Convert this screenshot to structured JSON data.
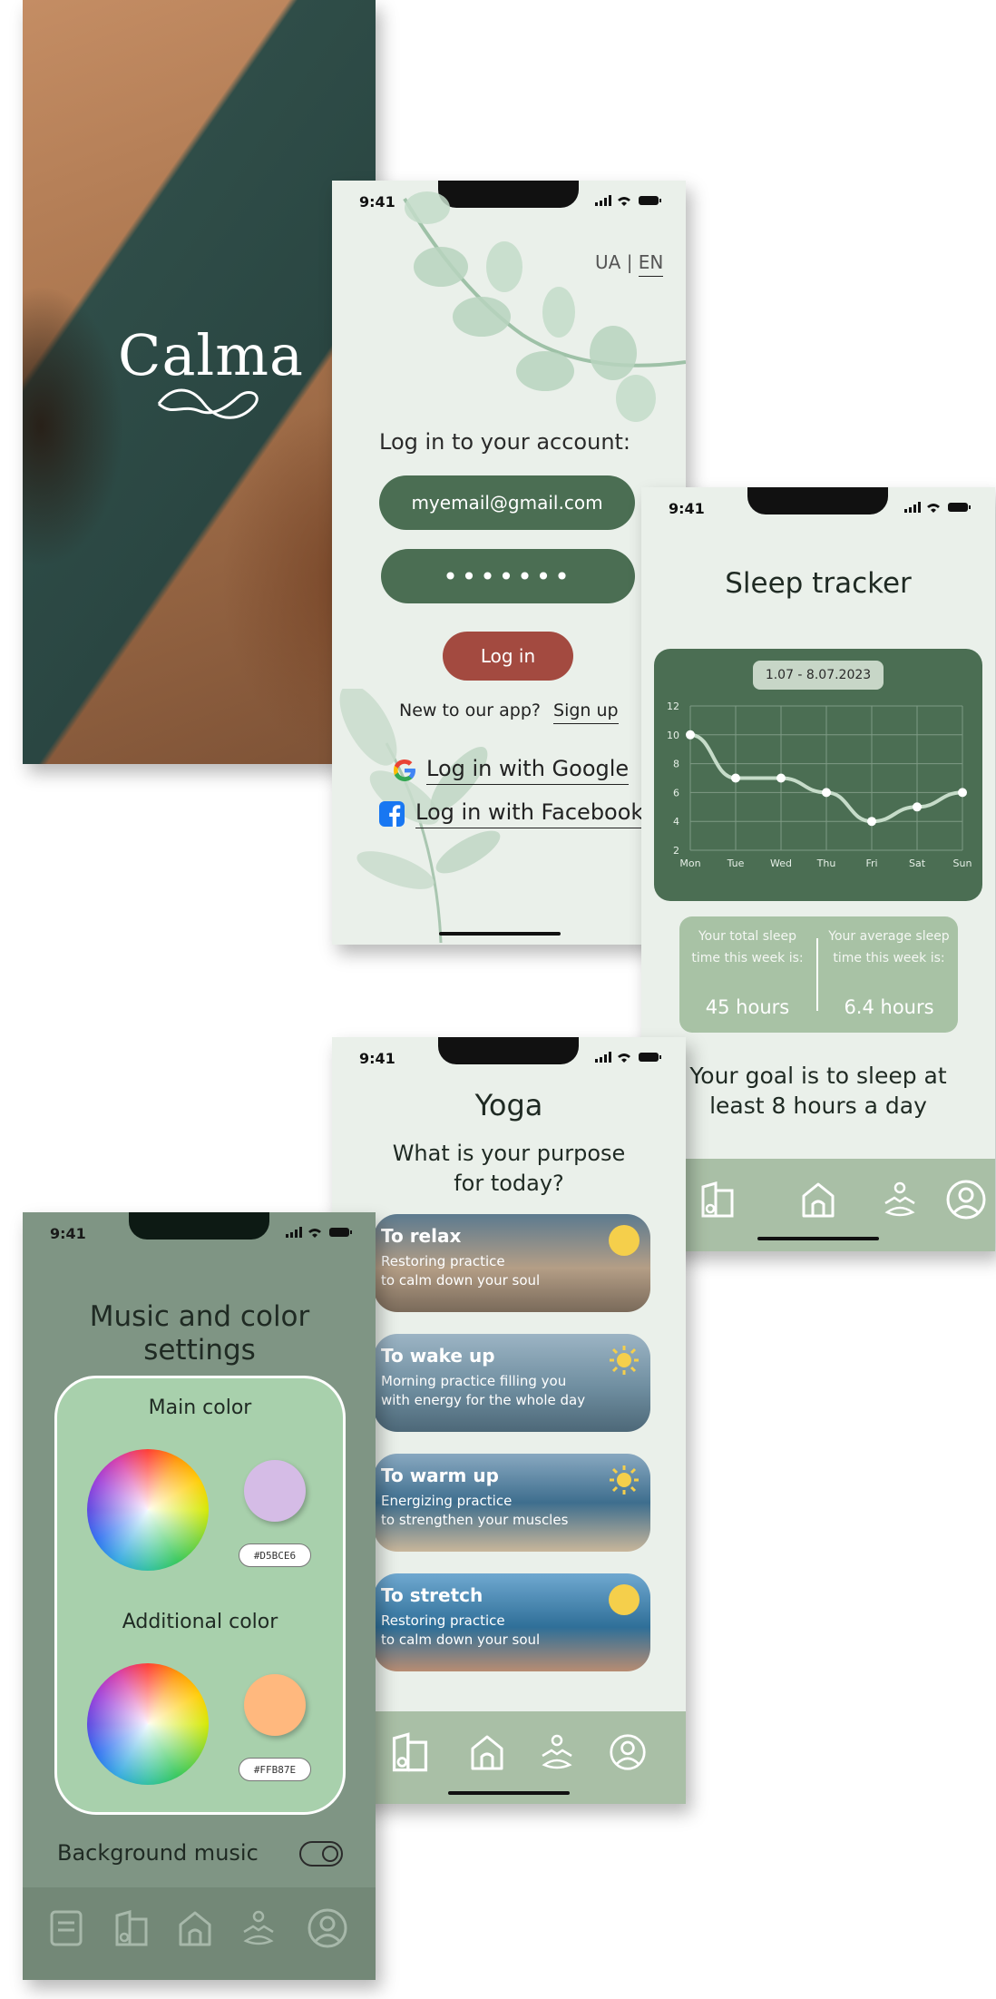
{
  "status_bar": {
    "time": "9:41"
  },
  "splash": {
    "brand": "Calma"
  },
  "login": {
    "lang_ua": "UA",
    "lang_sep": "|",
    "lang_en": "EN",
    "heading": "Log in to your account:",
    "email_value": "myemail@gmail.com",
    "password_value": "•••••••",
    "login_button": "Log in",
    "new_prompt": "New to our app?",
    "signup_link": "Sign up",
    "google_label": "Log in with Google",
    "facebook_label": "Log in with Facebook"
  },
  "sleep": {
    "title": "Sleep tracker",
    "date_range": "1.07 - 8.07.2023",
    "total_label": "Your total sleep time this week is:",
    "total_value": "45 hours",
    "average_label": "Your average sleep time this week is:",
    "average_value": "6.4 hours",
    "goal": "Your goal is to sleep at least 8 hours a day"
  },
  "chart_data": {
    "type": "line",
    "title": "",
    "xlabel": "",
    "ylabel": "",
    "categories": [
      "Mon",
      "Tue",
      "Wed",
      "Thu",
      "Fri",
      "Sat",
      "Sun"
    ],
    "values": [
      10,
      7,
      7,
      6,
      4,
      5,
      6
    ],
    "yticks": [
      2,
      4,
      6,
      8,
      10,
      12
    ],
    "ylim": [
      2,
      12
    ],
    "grid": true
  },
  "yoga": {
    "title": "Yoga",
    "question": "What is your purpose for today?",
    "cards": [
      {
        "title": "To relax",
        "line1": "Restoring practice",
        "line2": "to calm down your soul",
        "bg": "#b7a08a"
      },
      {
        "title": "To wake up",
        "line1": "Morning practice filling you",
        "line2": "with energy for the whole day",
        "bg": "#6f8ea0"
      },
      {
        "title": "To warm up",
        "line1": "Energizing practice",
        "line2": "to strengthen your muscles",
        "bg": "#3e6e8e"
      },
      {
        "title": "To stretch",
        "line1": "Restoring practice",
        "line2": "to calm down your soul",
        "bg": "#2f6f98"
      }
    ]
  },
  "settings": {
    "title": "Music and color settings",
    "main_color_label": "Main color",
    "main_color_hex": "#D5BCE6",
    "additional_color_label": "Additional color",
    "additional_color_hex": "#FFB87E",
    "music_label": "Background music"
  },
  "tabbar_icons": [
    "notes-icon",
    "journal-icon",
    "home-icon",
    "meditation-icon",
    "profile-icon"
  ],
  "colors": {
    "accent_green": "#4b6e53",
    "login_red": "#a34a40",
    "background": "#eaf0ea",
    "tabbar": "#a9bfa6"
  }
}
